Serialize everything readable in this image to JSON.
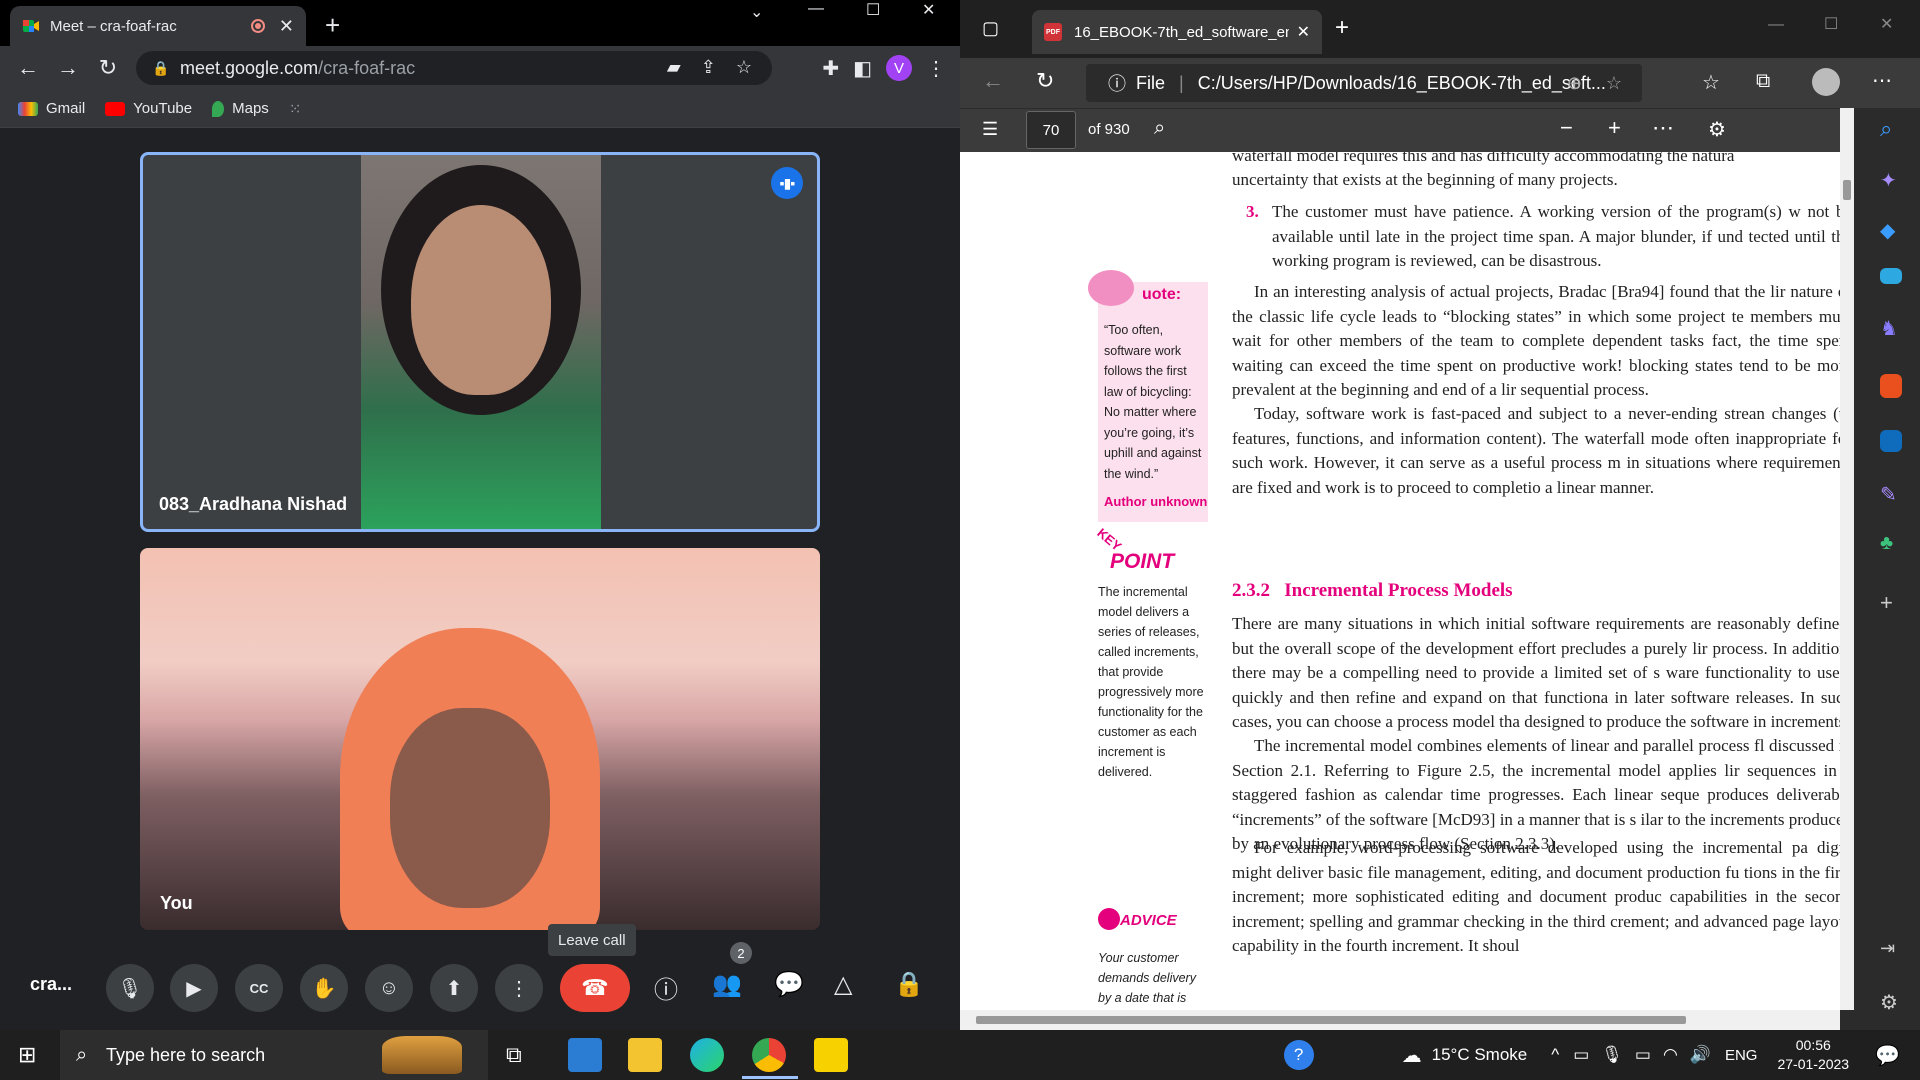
{
  "chrome": {
    "tab_title": "Meet – cra-foaf-rac",
    "url_host": "meet.google.com",
    "url_path": "/cra-foaf-rac",
    "profile_initial": "V",
    "bookmarks": [
      "Gmail",
      "YouTube",
      "Maps"
    ]
  },
  "meet": {
    "participant_name": "083_Aradhana Nishad",
    "self_label": "You",
    "meeting_code": "cra...",
    "tooltip": "Leave call",
    "people_count": "2"
  },
  "edge": {
    "tab_title": "16_EBOOK-7th_ed_software_eng",
    "file_label": "File",
    "file_path": "C:/Users/HP/Downloads/16_EBOOK-7th_ed_soft...",
    "page_number": "70",
    "page_total": "of 930"
  },
  "pdf": {
    "line_top": "waterfall model requires this and has difficulty accommodating the natura",
    "line_top2": "uncertainty that exists at the beginning of many projects.",
    "item3_num": "3.",
    "item3": "The customer must have patience. A working version of the program(s) w not be available until late in the project time span. A major blunder, if und tected until the working program is reviewed, can be disastrous.",
    "para1": "In an interesting analysis of actual projects, Bradac [Bra94] found that the lir nature of the classic life cycle leads to “blocking states” in which some project te members must wait for other members of the team to complete dependent tasks fact, the time spent waiting can exceed the time spent on productive work! blocking states tend to be more prevalent at the beginning and end of a lir sequential process.",
    "para2": "Today, software work is fast-paced and subject to a never-ending strean changes (to features, functions, and information content). The waterfall mode often inappropriate for such work. However, it can serve as a useful process m in situations where requirements are fixed and work is to proceed to completio a linear manner.",
    "section_num": "2.3.2",
    "section_title": "Incremental Process Models",
    "para3": "There are many situations in which initial software requirements are reasonably defined, but the overall scope of the development effort precludes a purely lir process. In addition, there may be a compelling need to provide a limited set of s ware functionality to users quickly and then refine and expand on that functiona in later software releases. In such cases, you can choose a process model tha designed to produce the software in increments.",
    "para4": "The incremental model combines elements of linear and parallel process fl discussed in Section 2.1. Referring to Figure 2.5, the incremental model applies lir sequences in a staggered fashion as calendar time progresses. Each linear seque produces deliverable “increments” of the software [McD93] in a manner that is s ilar to the increments produced by an evolutionary process flow (Section 2.3.3).",
    "para5": "For example, word-processing software developed using the incremental pa digm might deliver basic file management, editing, and document production fu tions in the first increment; more sophisticated editing and document produc capabilities in the second increment; spelling and grammar checking in the third crement; and advanced page layout capability in the fourth increment. It shoul",
    "quote_title": "uote:",
    "quote_text": "“Too often, software work follows the first law of bicycling: No matter where you’re going, it’s uphill and against the wind.”",
    "quote_author": "Author unknown",
    "keypoint_title": "POINT",
    "keypoint_text": "The incremental model delivers a series of releases, called increments, that provide progressively more functionality for the customer as each increment is delivered.",
    "advice_title": "ADVICE",
    "advice_text": "Your customer demands delivery by a date that is impossible"
  },
  "taskbar": {
    "search_placeholder": "Type here to search",
    "weather": "15°C  Smoke",
    "lang": "ENG",
    "time": "00:56",
    "date": "27-01-2023"
  }
}
